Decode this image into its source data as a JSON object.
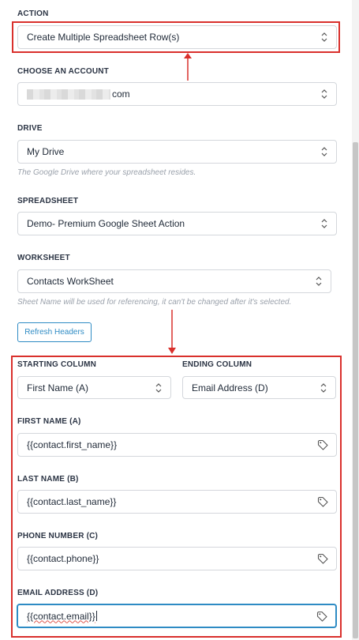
{
  "action": {
    "label": "ACTION",
    "value": "Create Multiple Spreadsheet Row(s)"
  },
  "account": {
    "label": "CHOOSE AN ACCOUNT",
    "value_suffix": "com"
  },
  "drive": {
    "label": "DRIVE",
    "value": "My Drive",
    "help": "The Google Drive where your spreadsheet resides."
  },
  "spreadsheet": {
    "label": "SPREADSHEET",
    "value": "Demo- Premium Google Sheet Action"
  },
  "worksheet": {
    "label": "WORKSHEET",
    "value": "Contacts WorkSheet",
    "help": "Sheet Name will be used for referencing, it can't be changed after it's selected."
  },
  "refresh_button": "Refresh Headers",
  "starting_column": {
    "label": "STARTING COLUMN",
    "value": "First Name (A)"
  },
  "ending_column": {
    "label": "ENDING COLUMN",
    "value": "Email Address (D)"
  },
  "fields": [
    {
      "label": "FIRST NAME (A)",
      "value": "{{contact.first_name}}"
    },
    {
      "label": "LAST NAME (B)",
      "value": "{{contact.last_name}}"
    },
    {
      "label": "PHONE NUMBER (C)",
      "value": "{{contact.phone}}"
    },
    {
      "label": "EMAIL ADDRESS (D)",
      "value": "{{contact.email}}"
    }
  ],
  "colors": {
    "annotation_red": "#d9302c",
    "accent_blue": "#2e8bc4"
  },
  "icons": {
    "select_chevron": "chevron-up-down-icon",
    "field_tag": "tag-icon"
  }
}
